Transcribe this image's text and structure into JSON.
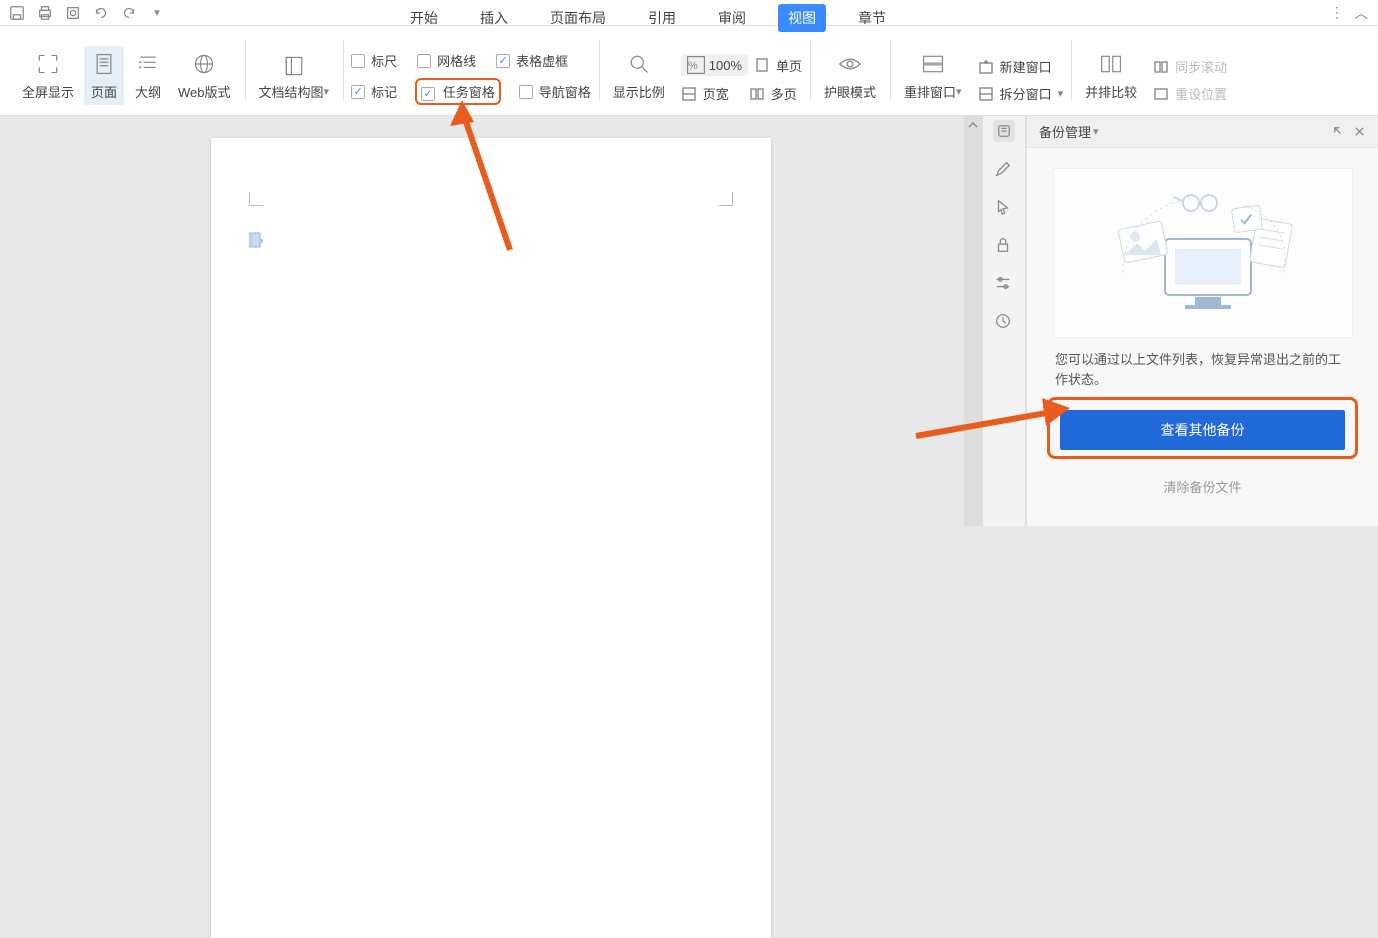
{
  "menu": {
    "start": "开始",
    "insert": "插入",
    "layout": "页面布局",
    "reference": "引用",
    "review": "审阅",
    "view": "视图",
    "chapter": "章节"
  },
  "ribbon": {
    "fullscreen": "全屏显示",
    "page": "页面",
    "outline": "大纲",
    "webview": "Web版式",
    "doc_structure": "文档结构图",
    "ruler": "标尺",
    "gridlines": "网格线",
    "table_outline": "表格虚框",
    "marks": "标记",
    "task_pane": "任务窗格",
    "nav_pane": "导航窗格",
    "zoom_ratio": "显示比例",
    "zoom_value": "100%",
    "single_page": "单页",
    "page_width": "页宽",
    "multi_page": "多页",
    "eye_care": "护眼模式",
    "re_window": "重排窗口",
    "new_window": "新建窗口",
    "split_window": "拆分窗口",
    "compare": "并排比较",
    "sync_scroll": "同步滚动",
    "reset_pos": "重设位置"
  },
  "panel": {
    "title": "备份管理",
    "desc": "您可以通过以上文件列表，恢复异常退出之前的工作状态。",
    "view_other": "查看其他备份",
    "clear": "清除备份文件"
  }
}
